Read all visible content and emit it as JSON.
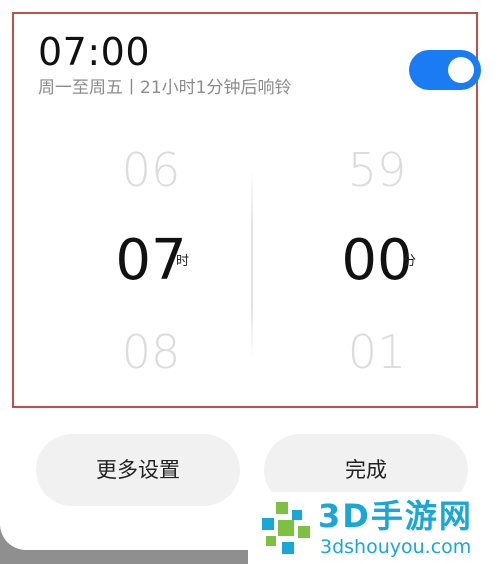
{
  "alarm": {
    "time": "07:00",
    "subtitle": "周一至周五丨21小时1分钟后响铃",
    "enabled": true
  },
  "picker": {
    "hours": {
      "above": "06",
      "selected": "07",
      "below": "08",
      "unit": "时"
    },
    "minutes": {
      "above": "59",
      "selected": "00",
      "below": "01",
      "unit": "分"
    }
  },
  "actions": {
    "more_settings_label": "更多设置",
    "done_label": "完成"
  },
  "watermark": {
    "title": "3D手游网",
    "url": "3dshouyou.com"
  },
  "colors": {
    "toggle_on": "#1a7cf2",
    "highlight_border": "#c0504d",
    "watermark": "#19a7d8"
  }
}
